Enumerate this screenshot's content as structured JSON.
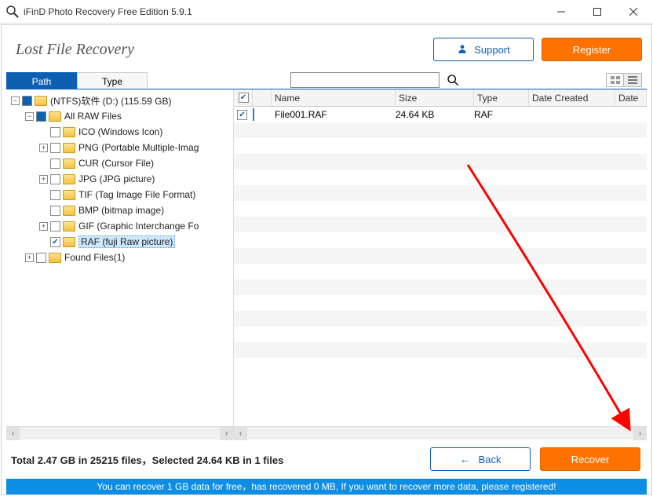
{
  "window": {
    "title": "iFinD Photo Recovery Free Edition 5.9.1"
  },
  "header": {
    "title": "Lost File Recovery",
    "support_label": "Support",
    "register_label": "Register"
  },
  "tabs": {
    "path_label": "Path",
    "type_label": "Type"
  },
  "search": {
    "placeholder": ""
  },
  "tree": {
    "root": "(NTFS)软件 (D:) (115.59 GB)",
    "all_raw": "All RAW Files",
    "nodes": [
      "ICO (Windows Icon)",
      "PNG (Portable Multiple-Imag",
      "CUR (Cursor File)",
      "JPG (JPG picture)",
      "TIF (Tag Image File Format)",
      "BMP (bitmap image)",
      "GIF (Graphic Interchange Fo",
      "RAF (fuji Raw picture)"
    ],
    "found_files": "Found Files(1)"
  },
  "columns": {
    "name": "Name",
    "size": "Size",
    "type": "Type",
    "date_created": "Date Created",
    "date2": "Date"
  },
  "files": [
    {
      "name": "File001.RAF",
      "size": "24.64 KB",
      "type": "RAF"
    }
  ],
  "footer": {
    "summary": "Total 2.47 GB in 25215 files，Selected 24.64 KB in 1 files",
    "back_label": "Back",
    "recover_label": "Recover",
    "banner": "You can recover 1 GB data for free，has recovered 0 MB, If you want to recover more data, please registered!"
  }
}
